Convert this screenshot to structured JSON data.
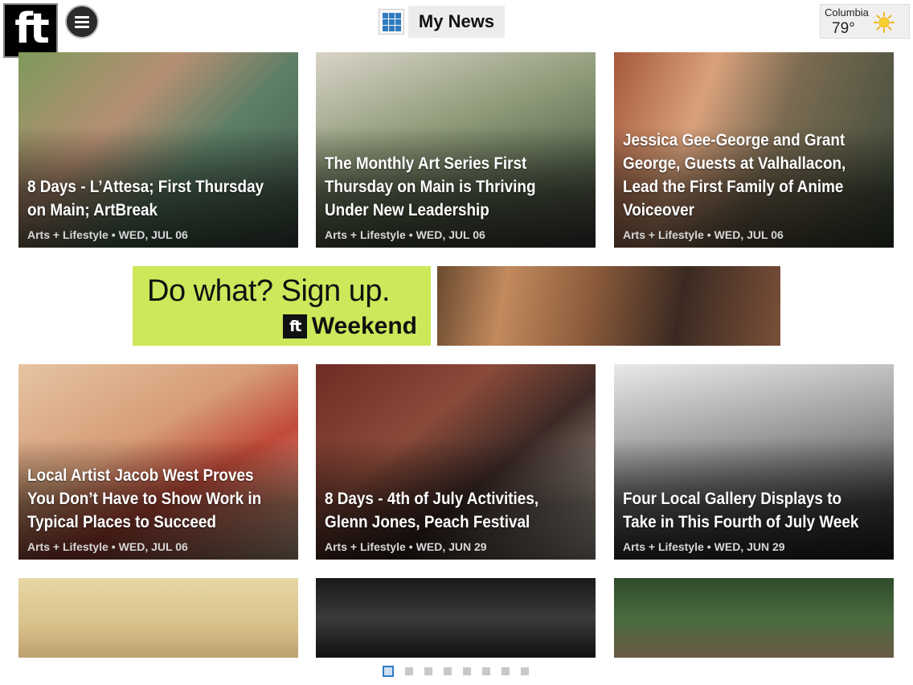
{
  "header": {
    "logo_text": "ft",
    "title": "My News",
    "weather": {
      "city": "Columbia",
      "temp": "79°",
      "icon": "sun-icon"
    }
  },
  "articles": [
    {
      "headline": "8 Days - L’Attesa; First Thursday on Main; ArtBreak",
      "category": "Arts + Lifestyle",
      "date": "WED, JUL 06"
    },
    {
      "headline": "The Monthly Art Series First Thursday on Main is Thriving Under New Leadership",
      "category": "Arts + Lifestyle",
      "date": "WED, JUL 06"
    },
    {
      "headline": "Jessica Gee-George and Grant George, Guests at Valhallacon, Lead the First Family of Anime Voiceover",
      "category": "Arts + Lifestyle",
      "date": "WED, JUL 06"
    },
    {
      "headline": "Local Artist Jacob West Proves You Don’t Have to Show Work in Typical Places to Succeed",
      "category": "Arts + Lifestyle",
      "date": "WED, JUL 06"
    },
    {
      "headline": "8 Days - 4th of July Activities, Glenn Jones, Peach Festival",
      "category": "Arts + Lifestyle",
      "date": "WED, JUN 29"
    },
    {
      "headline": "Four Local Gallery Displays to Take in This Fourth of July Week",
      "category": "Arts + Lifestyle",
      "date": "WED, JUN 29"
    }
  ],
  "ad": {
    "line1": "Do what? Sign up.",
    "logo_text": "ft",
    "line2": "Weekend"
  },
  "pager": {
    "total": 8,
    "active": 1
  },
  "colors": {
    "accent": "#2f7bbf",
    "ad_green": "#cde85a"
  }
}
